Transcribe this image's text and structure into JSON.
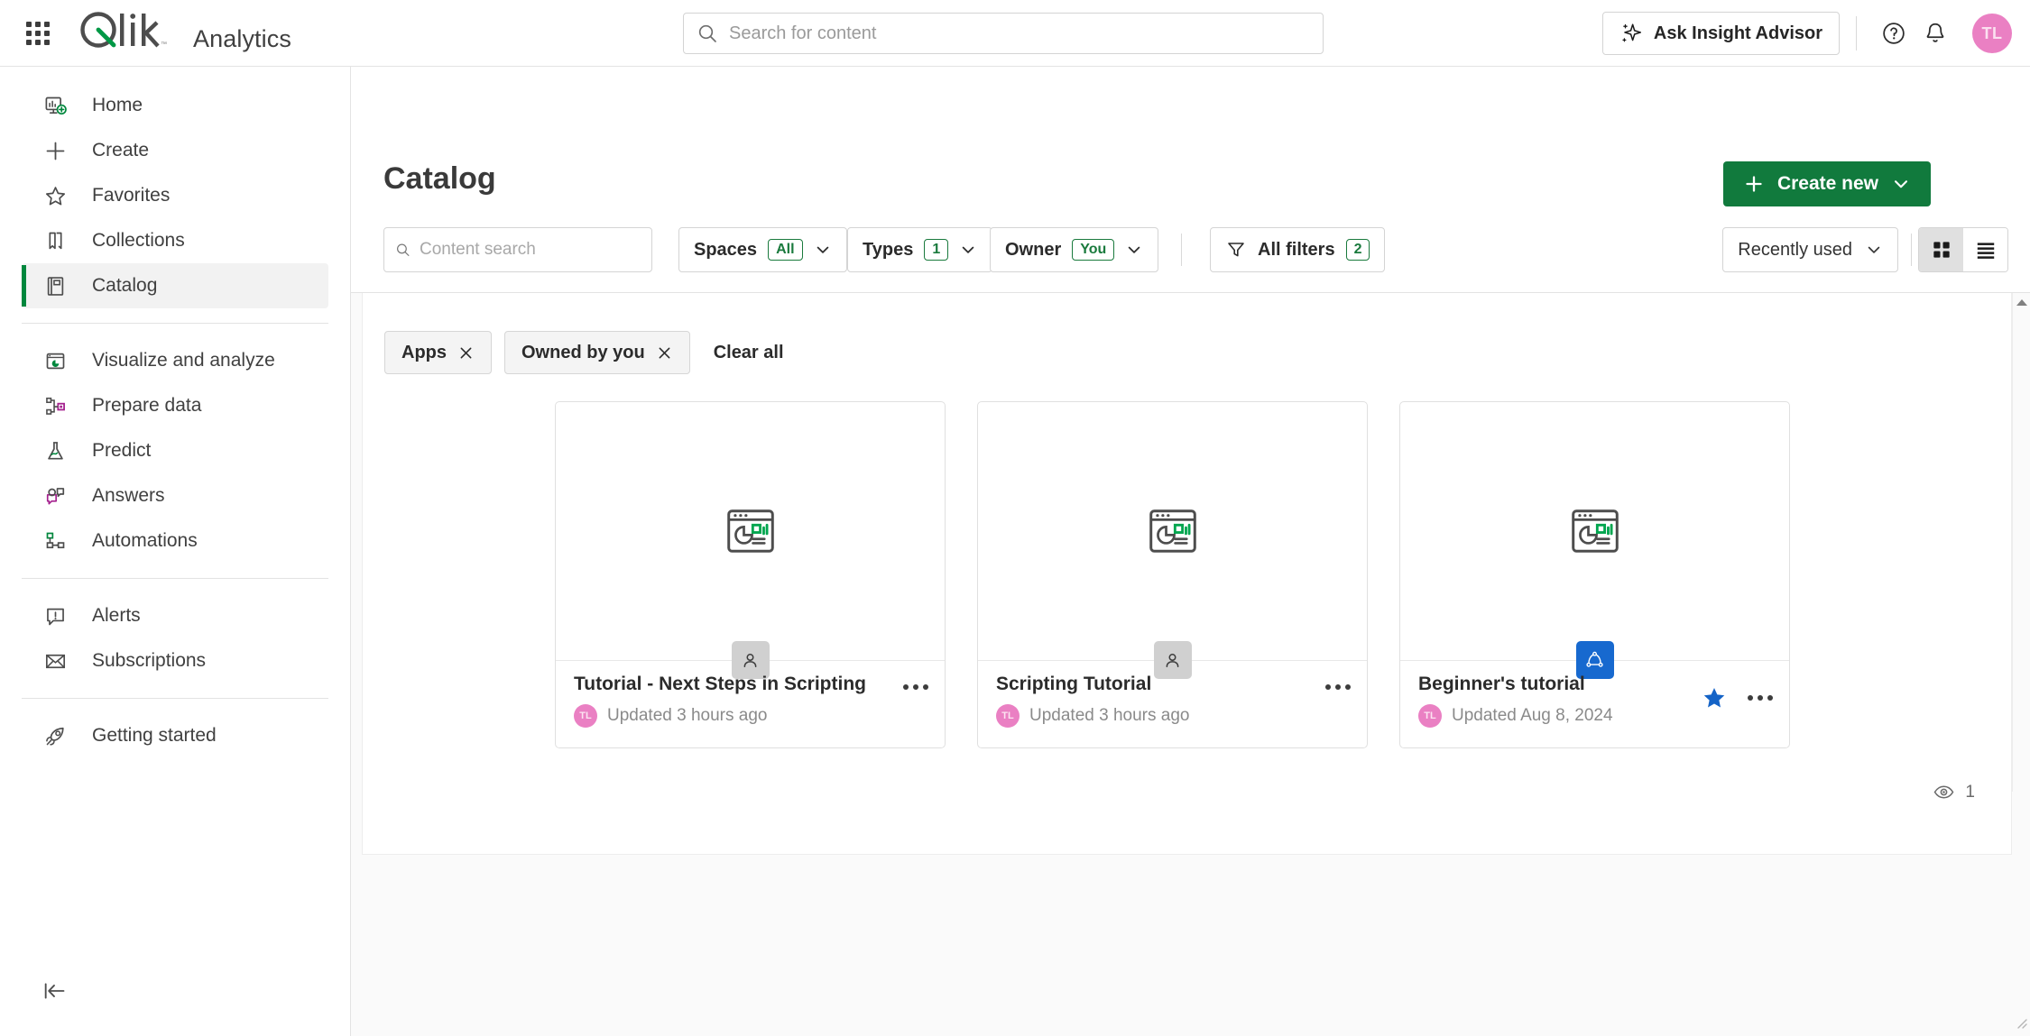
{
  "topbar": {
    "waffle_icon": "app-launcher-grid-icon",
    "brand_logo": "qlik-logo",
    "app_name": "Analytics",
    "search": {
      "placeholder": "Search for content",
      "value": "",
      "icon": "search-icon"
    },
    "ask_insight_advisor": {
      "label": "Ask Insight Advisor",
      "icon": "sparkle-icon"
    },
    "help_icon": "help-circle-icon",
    "notifications_icon": "bell-icon",
    "avatar": {
      "initials": "TL",
      "color": "#ea80c3"
    }
  },
  "sidebar": {
    "items": [
      {
        "label": "Home",
        "icon": "home-dashboard-icon",
        "active": false
      },
      {
        "label": "Create",
        "icon": "plus-icon",
        "active": false
      },
      {
        "label": "Favorites",
        "icon": "star-outline-icon",
        "active": false
      },
      {
        "label": "Collections",
        "icon": "bookmark-icon",
        "active": false
      },
      {
        "label": "Catalog",
        "icon": "catalog-book-icon",
        "active": true
      },
      {
        "label": "Visualize and analyze",
        "icon": "chart-window-icon",
        "active": false
      },
      {
        "label": "Prepare data",
        "icon": "data-nodes-icon",
        "active": false
      },
      {
        "label": "Predict",
        "icon": "flask-icon",
        "active": false
      },
      {
        "label": "Answers",
        "icon": "answers-chat-icon",
        "active": false
      },
      {
        "label": "Automations",
        "icon": "automation-flow-icon",
        "active": false
      },
      {
        "label": "Alerts",
        "icon": "alert-exclamation-icon",
        "active": false
      },
      {
        "label": "Subscriptions",
        "icon": "envelope-icon",
        "active": false
      },
      {
        "label": "Getting started",
        "icon": "rocket-icon",
        "active": false
      }
    ],
    "collapse_icon": "collapse-left-icon",
    "active_accent_color": "#00873d"
  },
  "main": {
    "page_title": "Catalog",
    "create_new": {
      "label": "Create new",
      "plus_icon": "plus-icon",
      "chevron_icon": "chevron-down-icon",
      "color": "#117a3d"
    },
    "toolbar": {
      "content_search": {
        "placeholder": "Content search",
        "value": "",
        "icon": "search-icon"
      },
      "spaces": {
        "label": "Spaces",
        "badge": "All",
        "chevron_icon": "chevron-down-icon"
      },
      "types": {
        "label": "Types",
        "badge": "1",
        "chevron_icon": "chevron-down-icon"
      },
      "owner": {
        "label": "Owner",
        "badge": "You",
        "chevron_icon": "chevron-down-icon"
      },
      "all_filters": {
        "label": "All filters",
        "badge": "2",
        "icon": "funnel-filter-icon"
      },
      "sort": {
        "label": "Recently used",
        "chevron_icon": "chevron-down-icon"
      },
      "view_grid": {
        "icon": "grid-view-icon",
        "selected": true
      },
      "view_list": {
        "icon": "list-view-icon",
        "selected": false
      }
    },
    "active_filters": {
      "chips": [
        {
          "label": "Apps",
          "remove_icon": "close-x-icon"
        },
        {
          "label": "Owned by you",
          "remove_icon": "close-x-icon"
        }
      ],
      "clear_all": "Clear all"
    },
    "cards": [
      {
        "title": "Tutorial - Next Steps in Scripting",
        "updated": "Updated 3 hours ago",
        "owner_initials": "TL",
        "thumb_icon": "app-chart-window-icon",
        "space_type": "personal",
        "space_icon": "person-icon",
        "favorite": false,
        "kebab_icon": "more-options-icon"
      },
      {
        "title": "Scripting Tutorial",
        "updated": "Updated 3 hours ago",
        "owner_initials": "TL",
        "thumb_icon": "app-chart-window-icon",
        "space_type": "personal",
        "space_icon": "person-icon",
        "favorite": false,
        "kebab_icon": "more-options-icon"
      },
      {
        "title": "Beginner's tutorial",
        "updated": "Updated Aug 8, 2024",
        "owner_initials": "TL",
        "thumb_icon": "app-chart-window-icon",
        "space_type": "shared",
        "space_icon": "shared-space-icon",
        "favorite": true,
        "favorite_icon": "star-filled-icon",
        "kebab_icon": "more-options-icon"
      }
    ],
    "views": {
      "icon": "eye-icon",
      "count": "1"
    }
  }
}
